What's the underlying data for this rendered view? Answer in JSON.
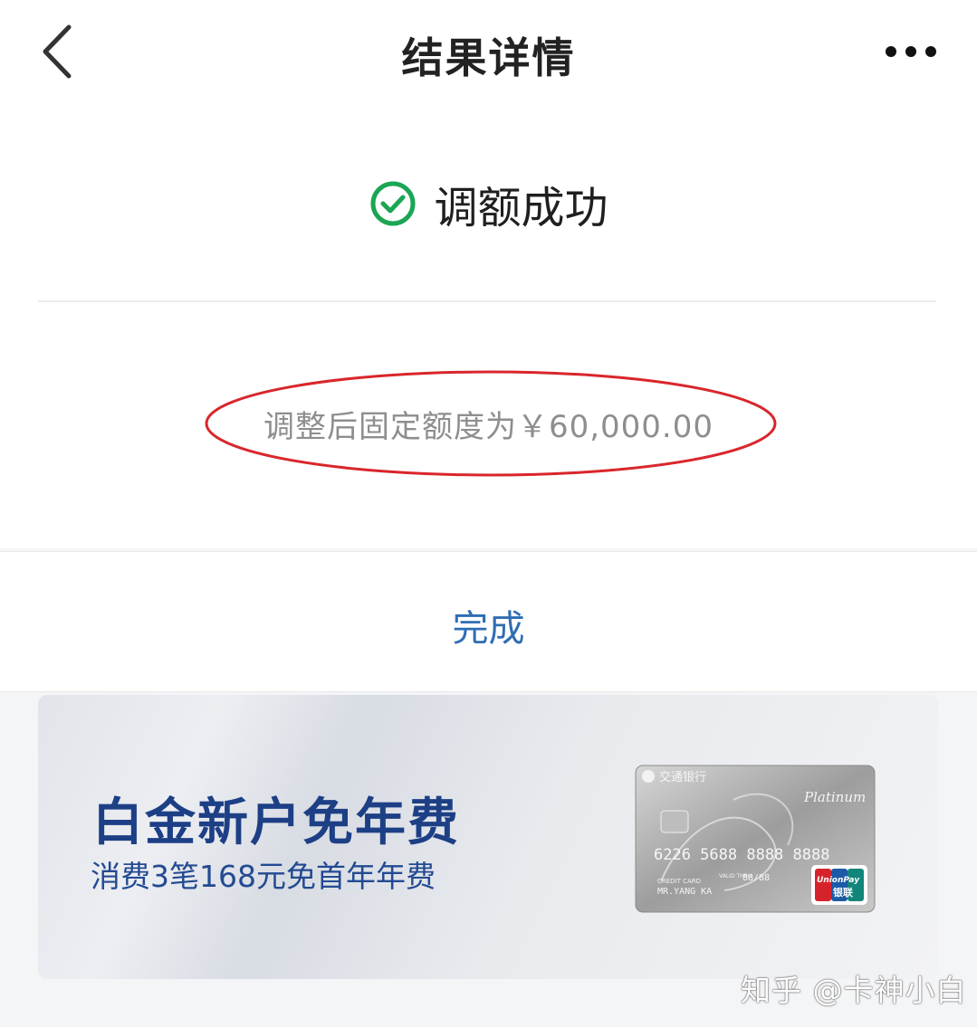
{
  "header": {
    "title": "结果详情",
    "back_icon": "chevron-left-icon",
    "more_icon": "more-dots-icon"
  },
  "status": {
    "icon": "check-circle-icon",
    "text": "调额成功",
    "color": "#1aa654"
  },
  "result": {
    "text": "调整后固定额度为￥60,000.00",
    "highlight_color": "#d9262c"
  },
  "actions": {
    "done_label": "完成"
  },
  "banner": {
    "title": "白金新户免年费",
    "subtitle": "消费3笔168元免首年年费",
    "card": {
      "bank_name": "交通银行",
      "tier": "Platinum",
      "number": "6226 5688 8888 8888",
      "type_label": "CREDIT CARD",
      "holder": "MR.YANG KA",
      "valid_label": "VALID THRU",
      "expiry": "88/88",
      "network": "UnionPay",
      "network_cn": "银联"
    }
  },
  "watermark": "知乎 @卡神小白"
}
